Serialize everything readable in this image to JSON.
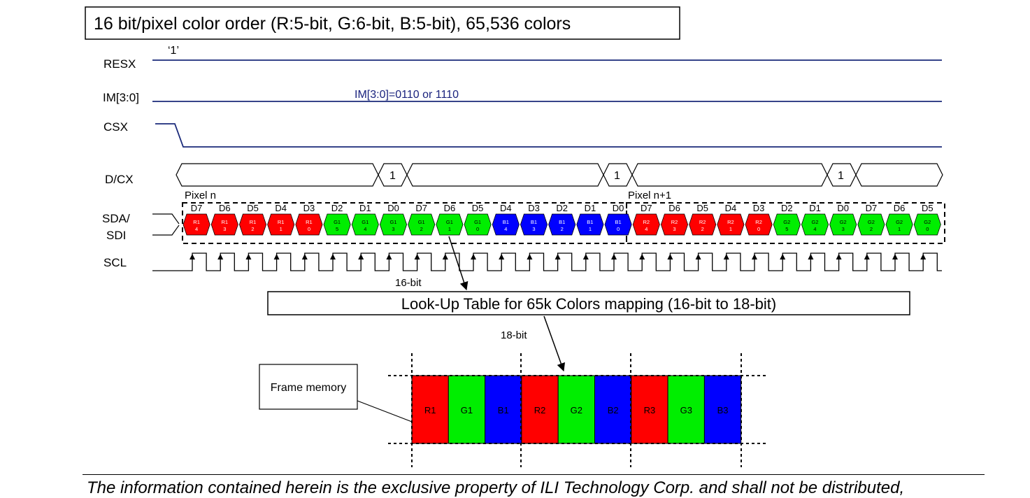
{
  "title": "16 bit/pixel color order (R:5-bit, G:6-bit, B:5-bit), 65,536 colors",
  "signals": {
    "resx": "RESX",
    "resx_value": "‘1’",
    "im": "IM[3:0]",
    "im_value": "IM[3:0]=0110 or 1110",
    "csx": "CSX",
    "dcx": "D/CX",
    "dcx_value": "1",
    "sda_line1": "SDA/",
    "sda_line2": "SDI",
    "scl": "SCL"
  },
  "pixel_labels": [
    "Pixel n",
    "Pixel n+1"
  ],
  "bits": [
    {
      "bit": "D7",
      "name": "R1",
      "idx": "4",
      "color": "red"
    },
    {
      "bit": "D6",
      "name": "R1",
      "idx": "3",
      "color": "red"
    },
    {
      "bit": "D5",
      "name": "R1",
      "idx": "2",
      "color": "red"
    },
    {
      "bit": "D4",
      "name": "R1",
      "idx": "1",
      "color": "red"
    },
    {
      "bit": "D3",
      "name": "R1",
      "idx": "0",
      "color": "red"
    },
    {
      "bit": "D2",
      "name": "G1",
      "idx": "5",
      "color": "green"
    },
    {
      "bit": "D1",
      "name": "G1",
      "idx": "4",
      "color": "green"
    },
    {
      "bit": "D0",
      "name": "G1",
      "idx": "3",
      "color": "green"
    },
    {
      "bit": "D7",
      "name": "G1",
      "idx": "2",
      "color": "green"
    },
    {
      "bit": "D6",
      "name": "G1",
      "idx": "1",
      "color": "green"
    },
    {
      "bit": "D5",
      "name": "G1",
      "idx": "0",
      "color": "green"
    },
    {
      "bit": "D4",
      "name": "B1",
      "idx": "4",
      "color": "blue"
    },
    {
      "bit": "D3",
      "name": "B1",
      "idx": "3",
      "color": "blue"
    },
    {
      "bit": "D2",
      "name": "B1",
      "idx": "2",
      "color": "blue"
    },
    {
      "bit": "D1",
      "name": "B1",
      "idx": "1",
      "color": "blue"
    },
    {
      "bit": "D0",
      "name": "B1",
      "idx": "0",
      "color": "blue"
    },
    {
      "bit": "D7",
      "name": "R2",
      "idx": "4",
      "color": "red"
    },
    {
      "bit": "D6",
      "name": "R2",
      "idx": "3",
      "color": "red"
    },
    {
      "bit": "D5",
      "name": "R2",
      "idx": "2",
      "color": "red"
    },
    {
      "bit": "D4",
      "name": "R2",
      "idx": "1",
      "color": "red"
    },
    {
      "bit": "D3",
      "name": "R2",
      "idx": "0",
      "color": "red"
    },
    {
      "bit": "D2",
      "name": "G2",
      "idx": "5",
      "color": "green"
    },
    {
      "bit": "D1",
      "name": "G2",
      "idx": "4",
      "color": "green"
    },
    {
      "bit": "D0",
      "name": "G2",
      "idx": "3",
      "color": "green"
    },
    {
      "bit": "D7",
      "name": "G2",
      "idx": "2",
      "color": "green"
    },
    {
      "bit": "D6",
      "name": "G2",
      "idx": "1",
      "color": "green"
    },
    {
      "bit": "D5",
      "name": "G2",
      "idx": "0",
      "color": "green"
    }
  ],
  "bit16_label": "16-bit",
  "lut_label": "Look-Up Table for 65k Colors mapping (16-bit to 18-bit)",
  "bit18_label": "18-bit",
  "frame_memory_label": "Frame memory",
  "frame_cells": [
    {
      "label": "R1",
      "color": "red"
    },
    {
      "label": "G1",
      "color": "green"
    },
    {
      "label": "B1",
      "color": "blue"
    },
    {
      "label": "R2",
      "color": "red"
    },
    {
      "label": "G2",
      "color": "green"
    },
    {
      "label": "B2",
      "color": "blue"
    },
    {
      "label": "R3",
      "color": "red"
    },
    {
      "label": "G3",
      "color": "green"
    },
    {
      "label": "B3",
      "color": "blue"
    }
  ],
  "colors": {
    "red": "#ff0000",
    "green": "#00ee00",
    "blue": "#0000ff",
    "signal_line": "#1a2a7a",
    "im_text": "#1a237e"
  },
  "footer": "The information contained herein is the exclusive property of ILI Technology Corp. and shall not be distributed,"
}
